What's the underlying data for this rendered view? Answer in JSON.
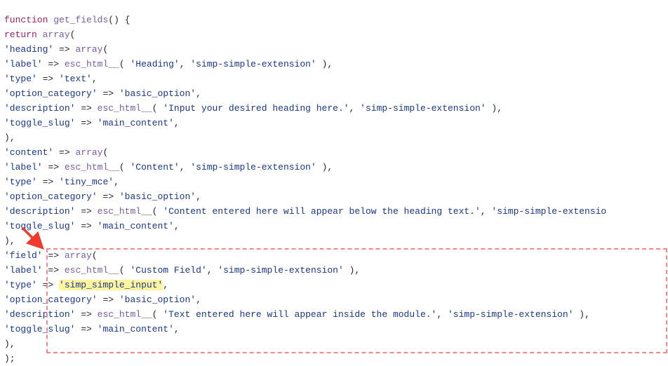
{
  "code": {
    "kw_function": "function",
    "kw_return": "return",
    "fn_name": "get_fields",
    "fn_array": "array",
    "fn_esc": "esc_html__",
    "k_heading": "'heading'",
    "k_content": "'content'",
    "k_field": "'field'",
    "k_label": "'label'",
    "k_type": "'type'",
    "k_option_category": "'option_category'",
    "k_description": "'description'",
    "k_toggle_slug": "'toggle_slug'",
    "v_heading_label1": "'Heading'",
    "v_heading_label2": "'simp-simple-extension'",
    "v_heading_type": "'text'",
    "v_basic_option": "'basic_option'",
    "v_heading_desc1": "'Input your desired heading here.'",
    "v_heading_desc2": "'simp-simple-extension'",
    "v_main_content": "'main_content'",
    "v_content_label1": "'Content'",
    "v_content_label2": "'simp-simple-extension'",
    "v_content_type": "'tiny_mce'",
    "v_content_desc1": "'Content entered here will appear below the heading text.'",
    "v_content_desc2": "'simp-simple-extensio",
    "v_field_label1": "'Custom Field'",
    "v_field_label2": "'simp-simple-extension'",
    "v_field_type": "'simp_simple_input'",
    "v_field_desc1": "'Text entered here will appear inside the module.'",
    "v_field_desc2": "'simp-simple-extension'",
    "sym_open_paren": "(",
    "sym_close_paren": ")",
    "sym_open_brace": "{",
    "sym_close_brace": "}",
    "sym_close_brace_semi": ");",
    "sym_comma": ",",
    "sym_end_semi": ");",
    "op_arrow": "=>"
  },
  "annotation": {
    "highlighted_section": "field-array-definition",
    "highlighted_value": "simp_simple_input",
    "arrow_points_to": "field-key"
  }
}
